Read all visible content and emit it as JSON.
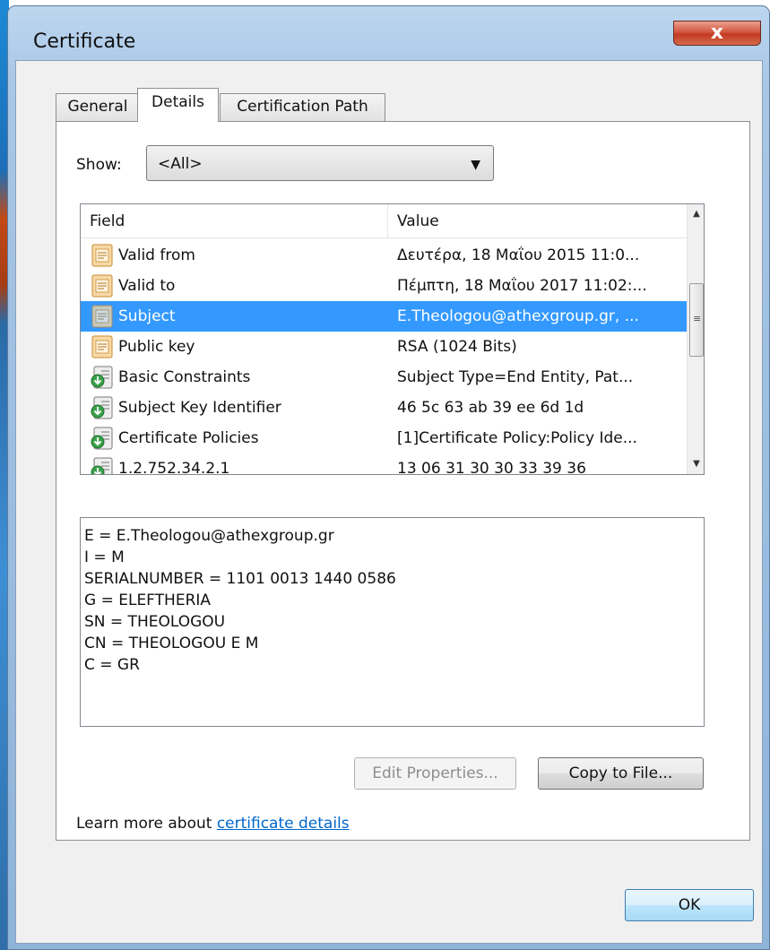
{
  "window": {
    "title": "Certificate",
    "close_label": "x"
  },
  "tabs": [
    {
      "label": "General",
      "active": false
    },
    {
      "label": "Details",
      "active": true
    },
    {
      "label": "Certification Path",
      "active": false
    }
  ],
  "show": {
    "label": "Show:",
    "value": "<All>"
  },
  "list": {
    "columns": [
      "Field",
      "Value"
    ],
    "rows": [
      {
        "icon": "document-icon",
        "field": "Valid from",
        "value": "Δευτέρα, 18 Μαΐου 2015 11:0...",
        "selected": false
      },
      {
        "icon": "document-icon",
        "field": "Valid to",
        "value": "Πέμπτη, 18 Μαΐου 2017 11:02:...",
        "selected": false
      },
      {
        "icon": "document-icon",
        "field": "Subject",
        "value": "E.Theologou@athexgroup.gr, ...",
        "selected": true
      },
      {
        "icon": "document-icon",
        "field": "Public key",
        "value": "RSA (1024 Bits)",
        "selected": false
      },
      {
        "icon": "extension-icon",
        "field": "Basic Constraints",
        "value": "Subject Type=End Entity, Pat...",
        "selected": false
      },
      {
        "icon": "extension-icon",
        "field": "Subject Key Identifier",
        "value": "46 5c 63 ab 39 ee 6d 1d",
        "selected": false
      },
      {
        "icon": "extension-icon",
        "field": "Certificate Policies",
        "value": "[1]Certificate Policy:Policy Ide...",
        "selected": false
      },
      {
        "icon": "extension-icon",
        "field": "1.2.752.34.2.1",
        "value": "13 06 31 30 30 33 39 36",
        "selected": false
      }
    ]
  },
  "detail": {
    "lines": [
      "E = E.Theologou@athexgroup.gr",
      "I = M",
      "SERIALNUMBER = 1101 0013 1440 0586",
      "G = ELEFTHERIA",
      "SN = THEOLOGOU",
      "CN = THEOLOGOU E M",
      "C = GR"
    ]
  },
  "buttons": {
    "edit_properties": "Edit Properties...",
    "copy_to_file": "Copy to File...",
    "ok": "OK"
  },
  "learn_more": {
    "prefix": "Learn more about ",
    "link_text": "certificate details"
  },
  "colors": {
    "selection": "#3399ff",
    "link": "#0066cc",
    "close_button": "#c23a22"
  }
}
